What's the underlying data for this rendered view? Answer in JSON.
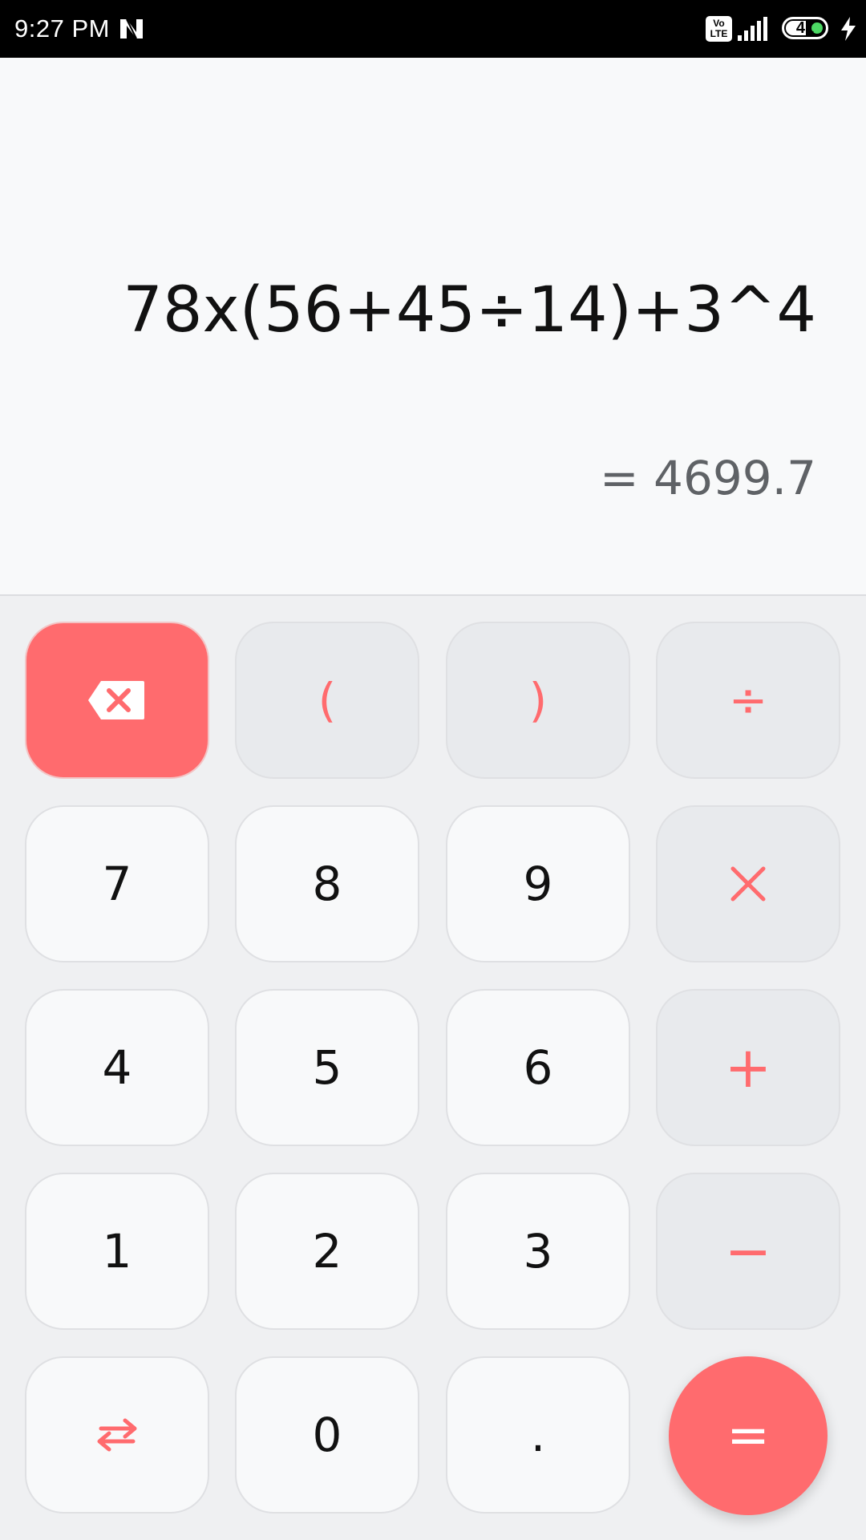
{
  "status_bar": {
    "time": "9:27 PM",
    "network_badge": "Vo\nLTE",
    "battery_percent": "41",
    "icons": [
      "n-notification-icon",
      "volte-icon",
      "signal-icon",
      "battery-icon",
      "charging-icon"
    ]
  },
  "display": {
    "expression": "78x(56+45÷14)+3^4",
    "result": "= 4699.7"
  },
  "keypad": {
    "backspace_icon": "backspace-icon",
    "open_paren": "(",
    "close_paren": ")",
    "divide": "÷",
    "multiply": "×",
    "plus": "+",
    "minus": "−",
    "equals": "=",
    "decimal": ".",
    "swap_icon": "swap-arrows-icon",
    "digits": {
      "d0": "0",
      "d1": "1",
      "d2": "2",
      "d3": "3",
      "d4": "4",
      "d5": "5",
      "d6": "6",
      "d7": "7",
      "d8": "8",
      "d9": "9"
    }
  },
  "colors": {
    "accent": "#ff6b6e",
    "key_background": "#f8f9fa",
    "operator_background": "#e8eaed",
    "page_background": "#eff0f2"
  }
}
